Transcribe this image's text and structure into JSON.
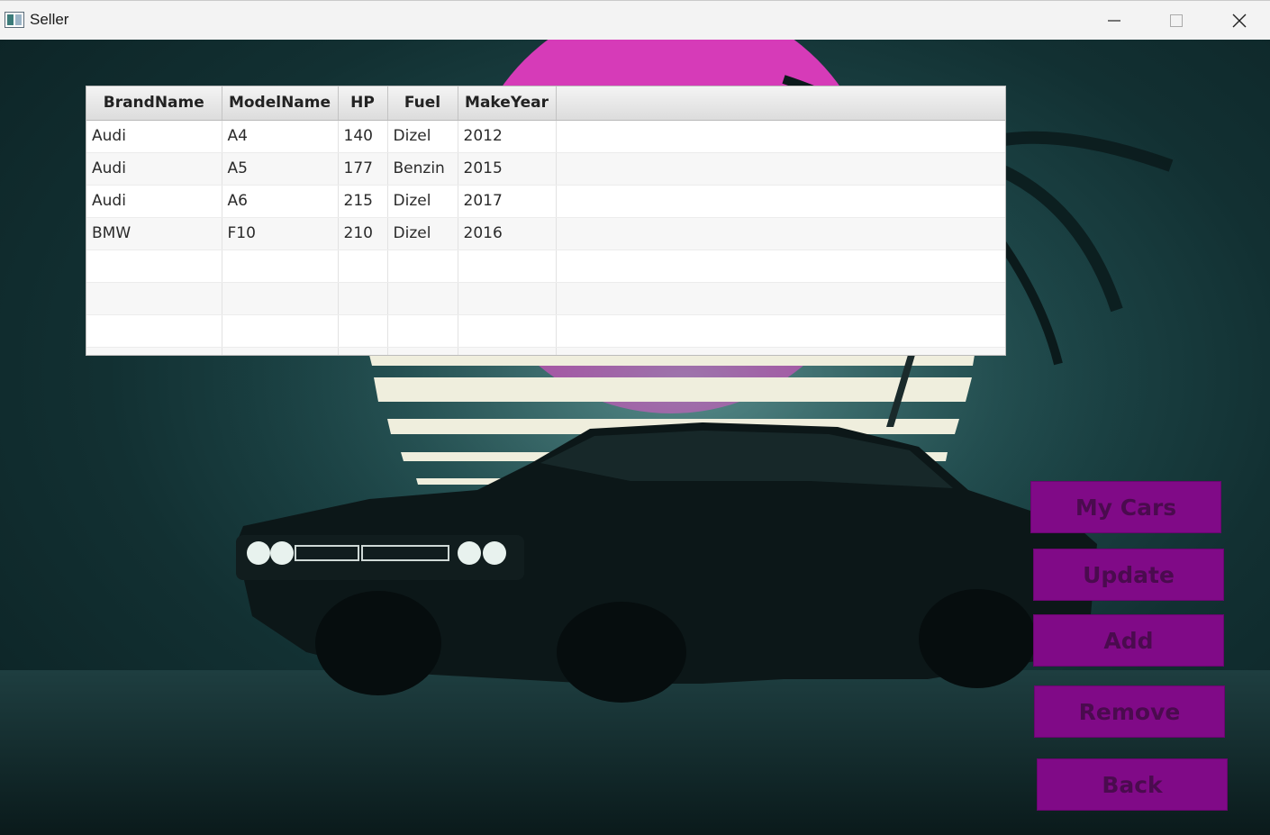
{
  "window": {
    "title": "Seller",
    "minimize_icon": "minimize-icon",
    "maximize_icon": "maximize-icon",
    "close_icon": "close-icon"
  },
  "table": {
    "columns": [
      "BrandName",
      "ModelName",
      "HP",
      "Fuel",
      "MakeYear"
    ],
    "rows": [
      [
        "Audi",
        "A4",
        "140",
        "Dizel",
        "2012"
      ],
      [
        "Audi",
        "A5",
        "177",
        "Benzin",
        "2015"
      ],
      [
        "Audi",
        "A6",
        "215",
        "Dizel",
        "2017"
      ],
      [
        "BMW",
        "F10",
        "210",
        "Dizel",
        "2016"
      ]
    ]
  },
  "buttons": {
    "my_cars": "My Cars",
    "update": "Update",
    "add": "Add",
    "remove": "Remove",
    "back": "Back"
  },
  "colors": {
    "button_bg": "#800a87",
    "button_text": "#4a0b4e",
    "sun": "#d63bb8"
  }
}
